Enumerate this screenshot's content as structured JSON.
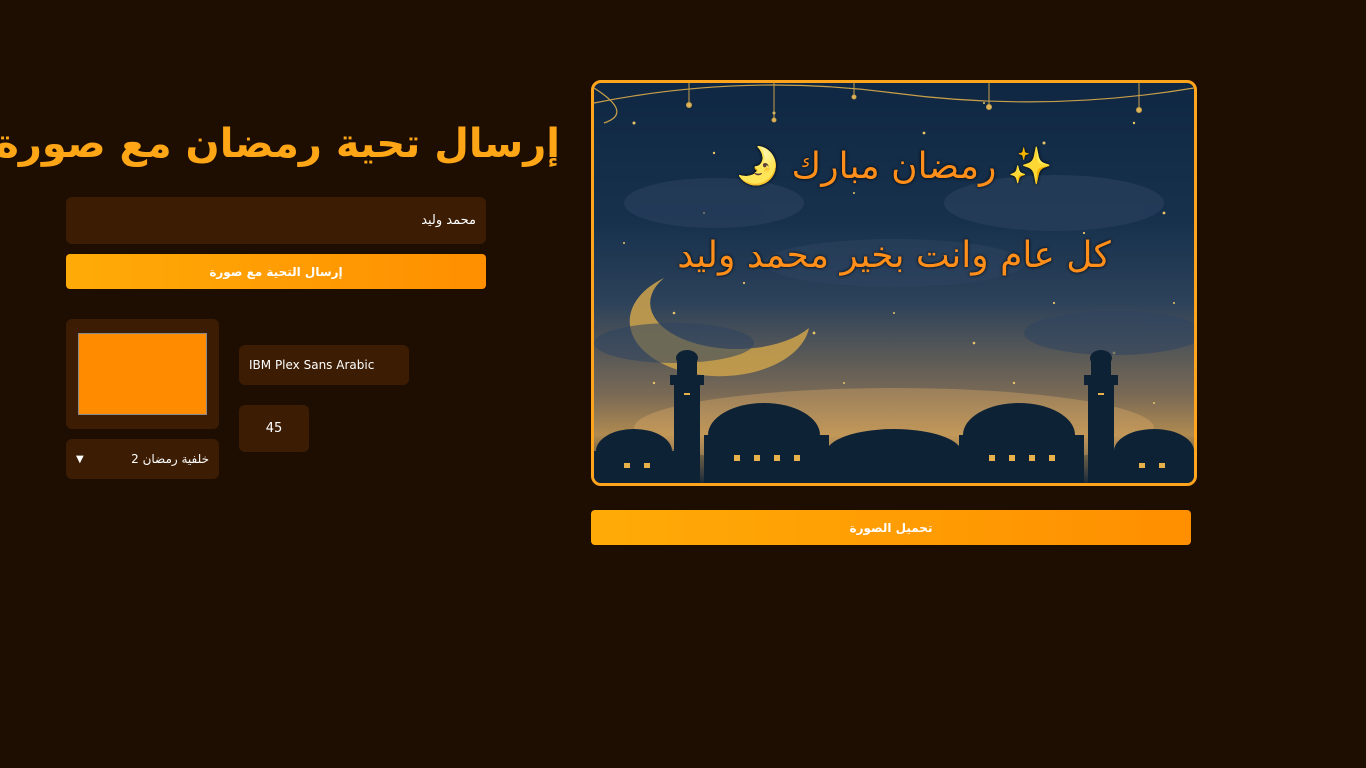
{
  "page": {
    "title": "إرسال تحية رمضان مع صورة"
  },
  "form": {
    "name_value": "محمد وليد",
    "send_button": "إرسال التحية مع صورة",
    "text_color": "#ff8c00",
    "background_select": "خلفية رمضان 2",
    "font_select": "IBM Plex Sans Arabic",
    "font_size": "45"
  },
  "card": {
    "line1": "✨ رمضان مبارك 🌛",
    "line2": "كل عام وانت بخير محمد وليد",
    "border_color": "#ffa51d"
  },
  "actions": {
    "download_button": "تحميل الصورة"
  },
  "colors": {
    "accent": "#ffa617",
    "background": "#1e0e02",
    "field": "#3c1d04"
  }
}
